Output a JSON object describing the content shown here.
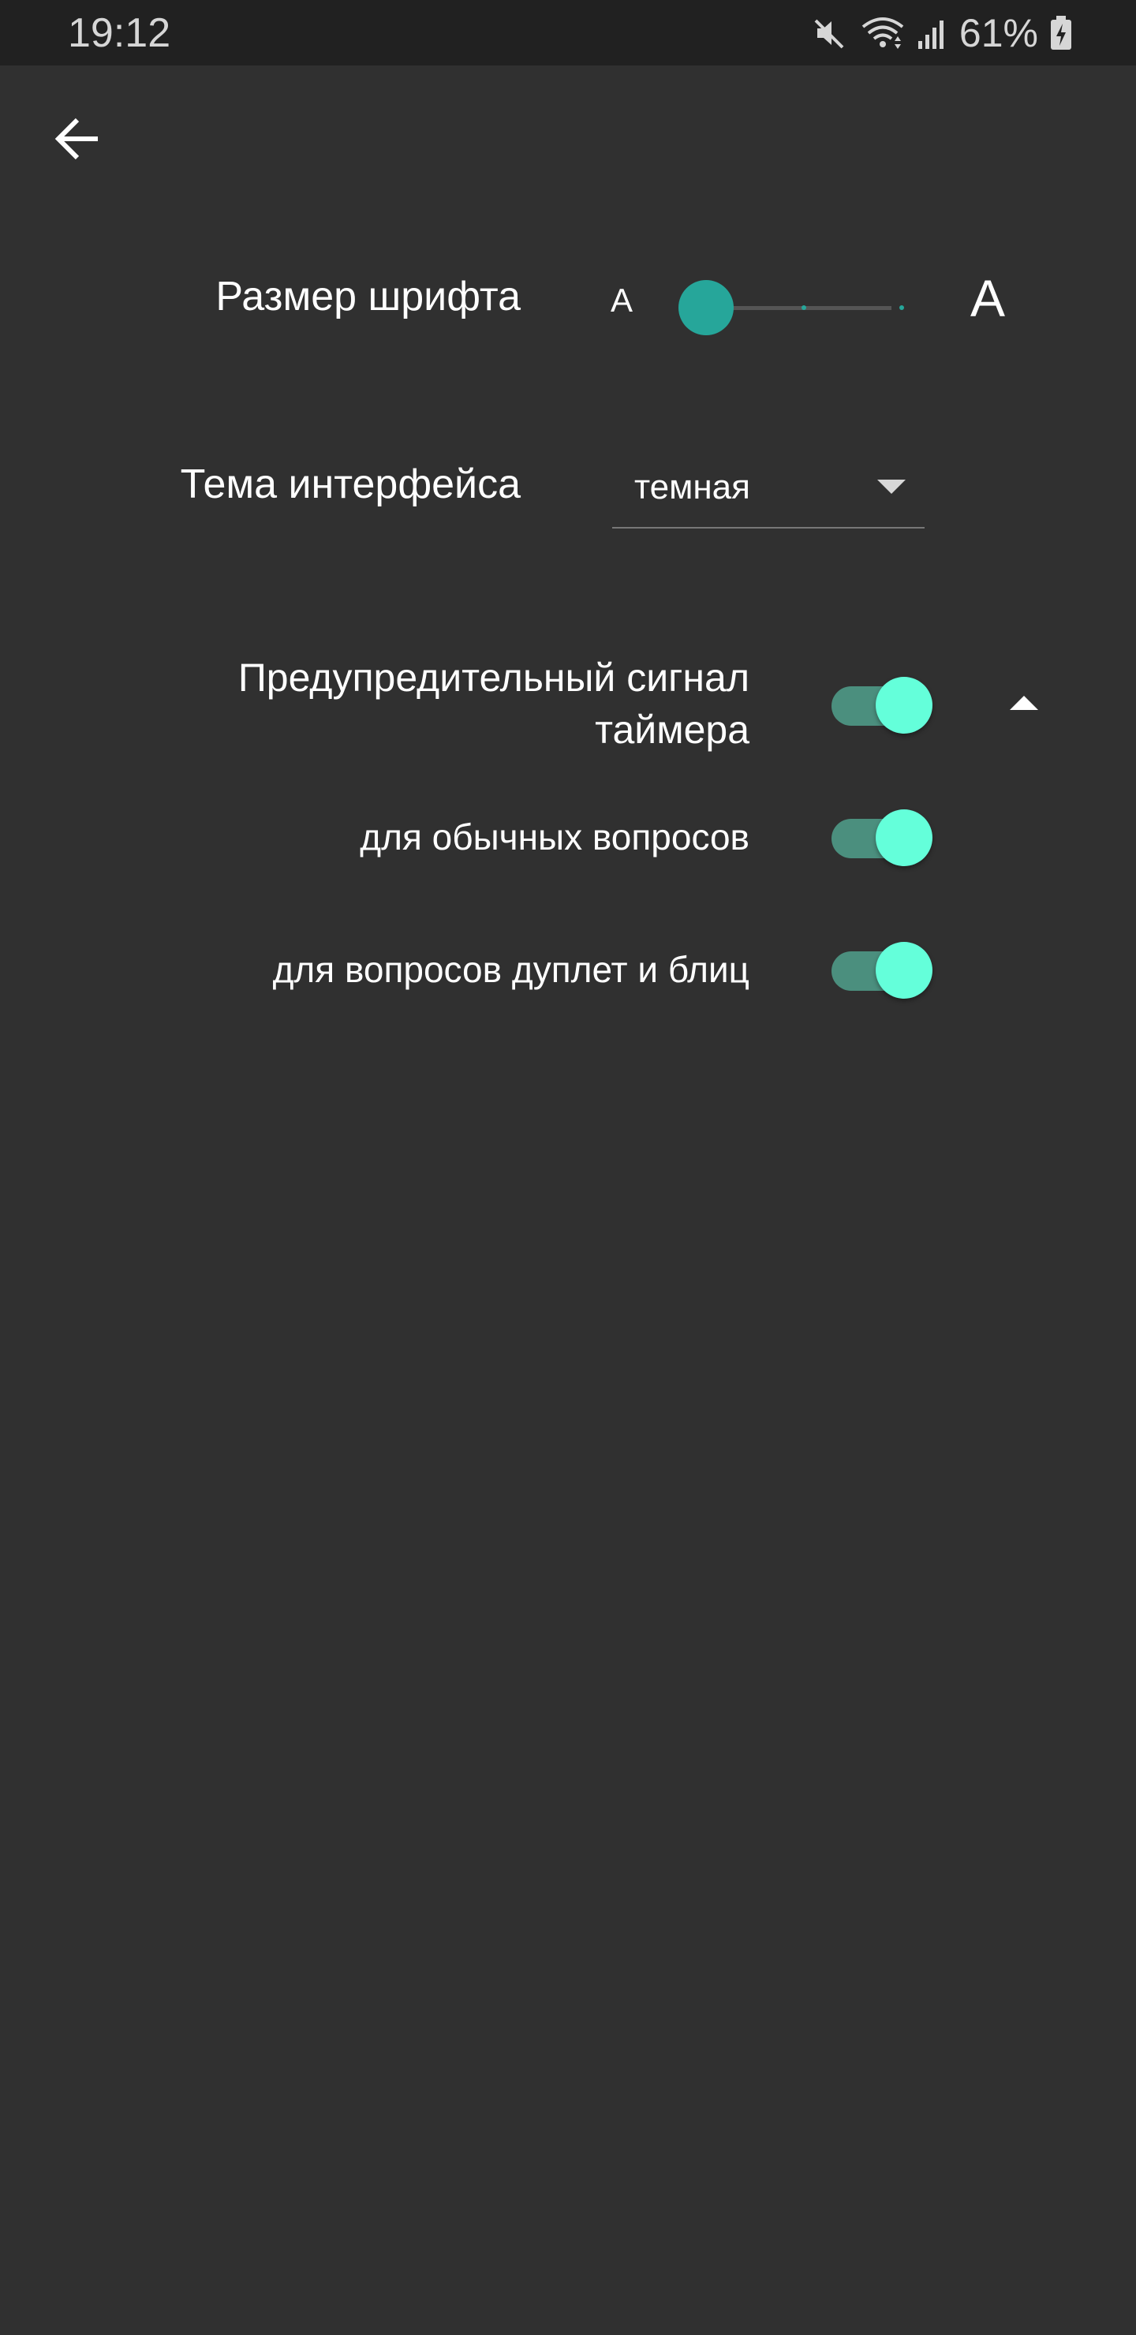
{
  "status_bar": {
    "time": "19:12",
    "battery_percent": "61%",
    "icons": [
      "mute-icon",
      "wifi-icon",
      "signal-icon",
      "battery-charging-icon"
    ]
  },
  "navigation": {
    "back_icon": "arrow-back-icon"
  },
  "settings": {
    "font_size": {
      "label": "Размер шрифта",
      "small_glyph": "A",
      "large_glyph": "A",
      "slider_steps": 3,
      "slider_position": 0
    },
    "theme": {
      "label": "Тема интерфейса",
      "selected": "темная"
    },
    "timer_signal": {
      "label_line1": "Предупредительный сигнал",
      "label_line2": "таймера",
      "enabled": true,
      "expanded": true,
      "options": [
        {
          "label": "для обычных вопросов",
          "enabled": true
        },
        {
          "label": "для вопросов дуплет и блиц",
          "enabled": true
        }
      ]
    }
  },
  "colors": {
    "background": "#303030",
    "status_bar": "#212121",
    "accent": "#26a69a",
    "switch_thumb": "#64ffda",
    "switch_track": "#4b8f7e"
  }
}
